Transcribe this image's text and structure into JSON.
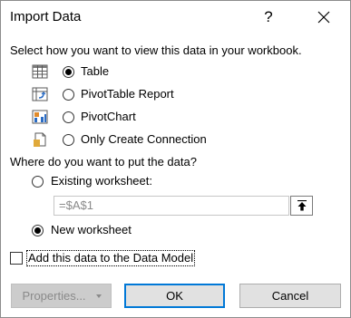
{
  "dialog": {
    "title": "Import Data",
    "help_glyph": "?",
    "view_prompt": "Select how you want to view this data in your workbook.",
    "view_options": [
      {
        "icon": "table-icon",
        "label": "Table",
        "selected": true
      },
      {
        "icon": "pivottable-icon",
        "label": "PivotTable Report",
        "selected": false
      },
      {
        "icon": "pivotchart-icon",
        "label": "PivotChart",
        "selected": false
      },
      {
        "icon": "connection-icon",
        "label": "Only Create Connection",
        "selected": false
      }
    ],
    "put_prompt": "Where do you want to put the data?",
    "put_options": [
      {
        "label": "Existing worksheet:",
        "selected": false
      },
      {
        "label": "New worksheet",
        "selected": true
      }
    ],
    "range_value": "=$A$1",
    "data_model_label": "Add this data to the Data Model",
    "data_model_checked": false,
    "buttons": {
      "properties": "Properties...",
      "ok": "OK",
      "cancel": "Cancel"
    }
  }
}
